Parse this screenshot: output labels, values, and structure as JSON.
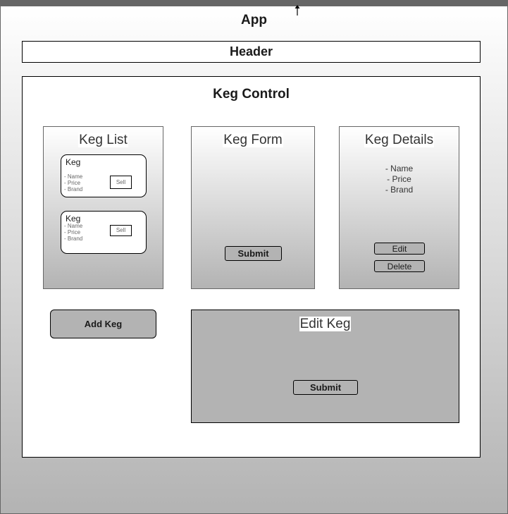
{
  "app": {
    "title": "App"
  },
  "header": {
    "label": "Header"
  },
  "keg_control": {
    "title": "Keg Control"
  },
  "keg_list": {
    "title": "Keg List",
    "cards": [
      {
        "name": "Keg",
        "props": [
          "- Name",
          "- Price",
          "- Brand"
        ],
        "sell_label": "Sell"
      },
      {
        "name": "Keg",
        "props": [
          "- Name",
          "- Price",
          "- Brand"
        ],
        "sell_label": "Sell"
      }
    ]
  },
  "keg_form": {
    "title": "Keg Form",
    "submit_label": "Submit"
  },
  "keg_details": {
    "title": "Keg Details",
    "props": [
      "- Name",
      "- Price",
      "- Brand"
    ],
    "edit_label": "Edit",
    "delete_label": "Delete"
  },
  "add_keg": {
    "label": "Add Keg"
  },
  "edit_keg": {
    "title": "Edit Keg",
    "submit_label": "Submit"
  },
  "colors": {
    "frame_border": "#666666",
    "gradient_top": "#ffffff",
    "gradient_bottom": "#b3b3b3",
    "button_fill": "#b3b3b3"
  },
  "icons": {
    "cursor": "arrow-up-icon"
  }
}
